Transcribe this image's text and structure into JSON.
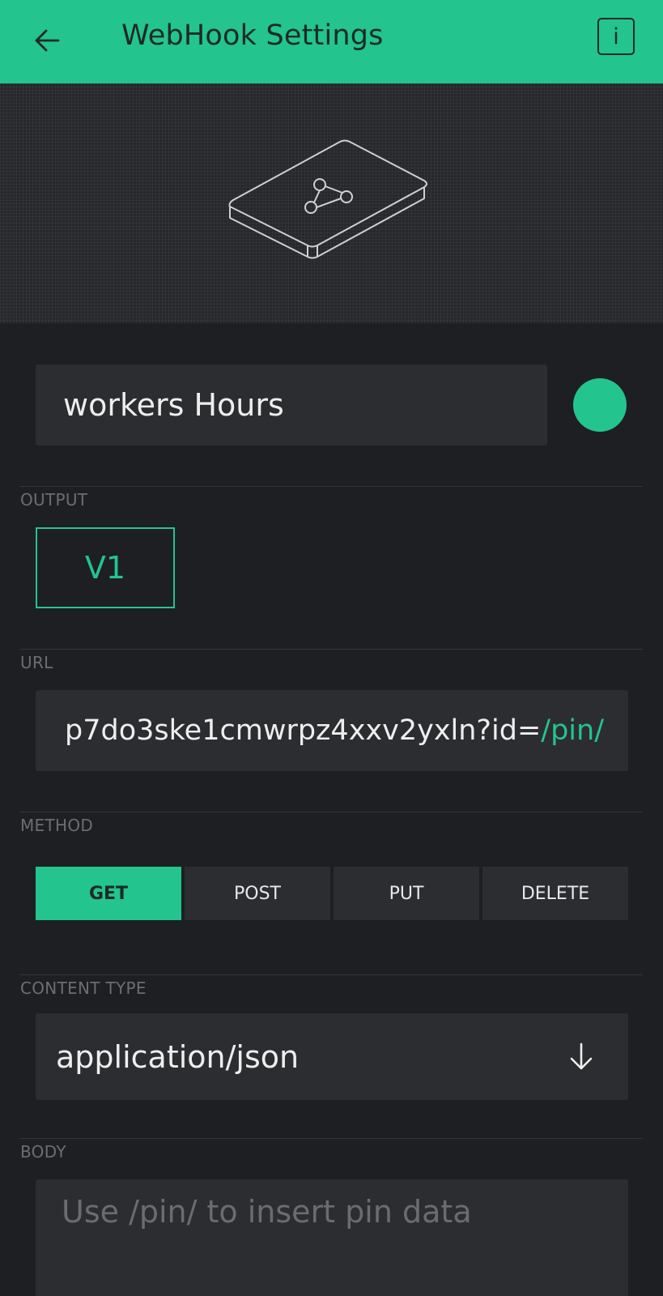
{
  "header": {
    "title": "WebHook Settings",
    "back_icon": "arrow-left-icon",
    "info_icon": "info-icon",
    "info_glyph": "i"
  },
  "hero": {
    "icon": "webhook-device-icon"
  },
  "widget": {
    "name": "workers Hours",
    "color": "#23c48e"
  },
  "output": {
    "label": "OUTPUT",
    "pin": "V1"
  },
  "url": {
    "label": "URL",
    "value_prefix": "p7do3ske1cmwrpz4xxv2yxln?id=",
    "value_pin": "/pin/"
  },
  "method": {
    "label": "METHOD",
    "options": [
      "GET",
      "POST",
      "PUT",
      "DELETE"
    ],
    "selected": "GET"
  },
  "content_type": {
    "label": "CONTENT TYPE",
    "value": "application/json",
    "dropdown_icon": "arrow-down-icon"
  },
  "body": {
    "label": "BODY",
    "placeholder": "Use /pin/ to insert pin data"
  },
  "colors": {
    "accent": "#23c48e",
    "background": "#1e1f22",
    "field": "#2c2d31"
  }
}
